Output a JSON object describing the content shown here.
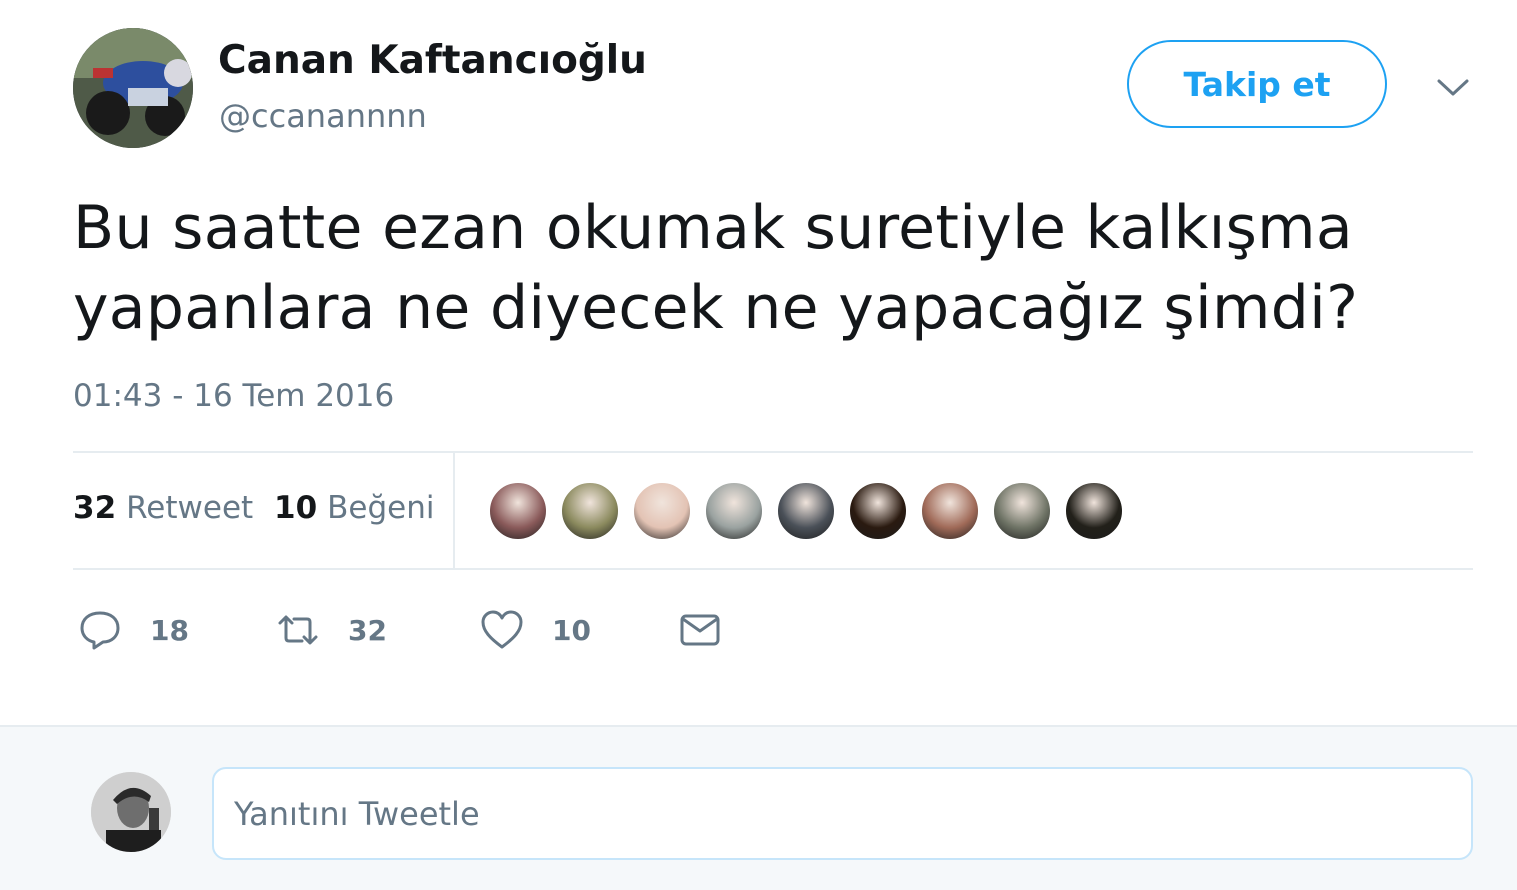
{
  "tweet": {
    "author_name": "Canan Kaftancıoğlu",
    "author_handle": "@ccanannnn",
    "follow_label": "Takip et",
    "text": "Bu saatte ezan okumak suretiyle kalkışma yapanlara ne diyecek ne yapacağız şimdi?",
    "timestamp": "01:43 - 16 Tem 2016"
  },
  "stats": {
    "retweet_count": "32",
    "retweet_label": "Retweet",
    "like_count": "10",
    "like_label": "Beğeni",
    "likers": [
      {
        "icon": "liker-avatar-1",
        "color": "#8a5a5a"
      },
      {
        "icon": "liker-avatar-2",
        "color": "#8b8a5e"
      },
      {
        "icon": "liker-avatar-3",
        "color": "#e3c3b4"
      },
      {
        "icon": "liker-avatar-4",
        "color": "#9aa2a0"
      },
      {
        "icon": "liker-avatar-5",
        "color": "#4a5058"
      },
      {
        "icon": "liker-avatar-6",
        "color": "#2a1a10"
      },
      {
        "icon": "liker-avatar-7",
        "color": "#a06a58"
      },
      {
        "icon": "liker-avatar-8",
        "color": "#6f7466"
      },
      {
        "icon": "liker-avatar-9",
        "color": "#22201a"
      }
    ]
  },
  "actions": {
    "reply_count": "18",
    "retweet_count": "32",
    "like_count": "10"
  },
  "reply_box": {
    "placeholder": "Yanıtını Tweetle"
  },
  "colors": {
    "accent": "#1da1f2",
    "muted": "#657786",
    "divider": "#e6ecf0"
  }
}
